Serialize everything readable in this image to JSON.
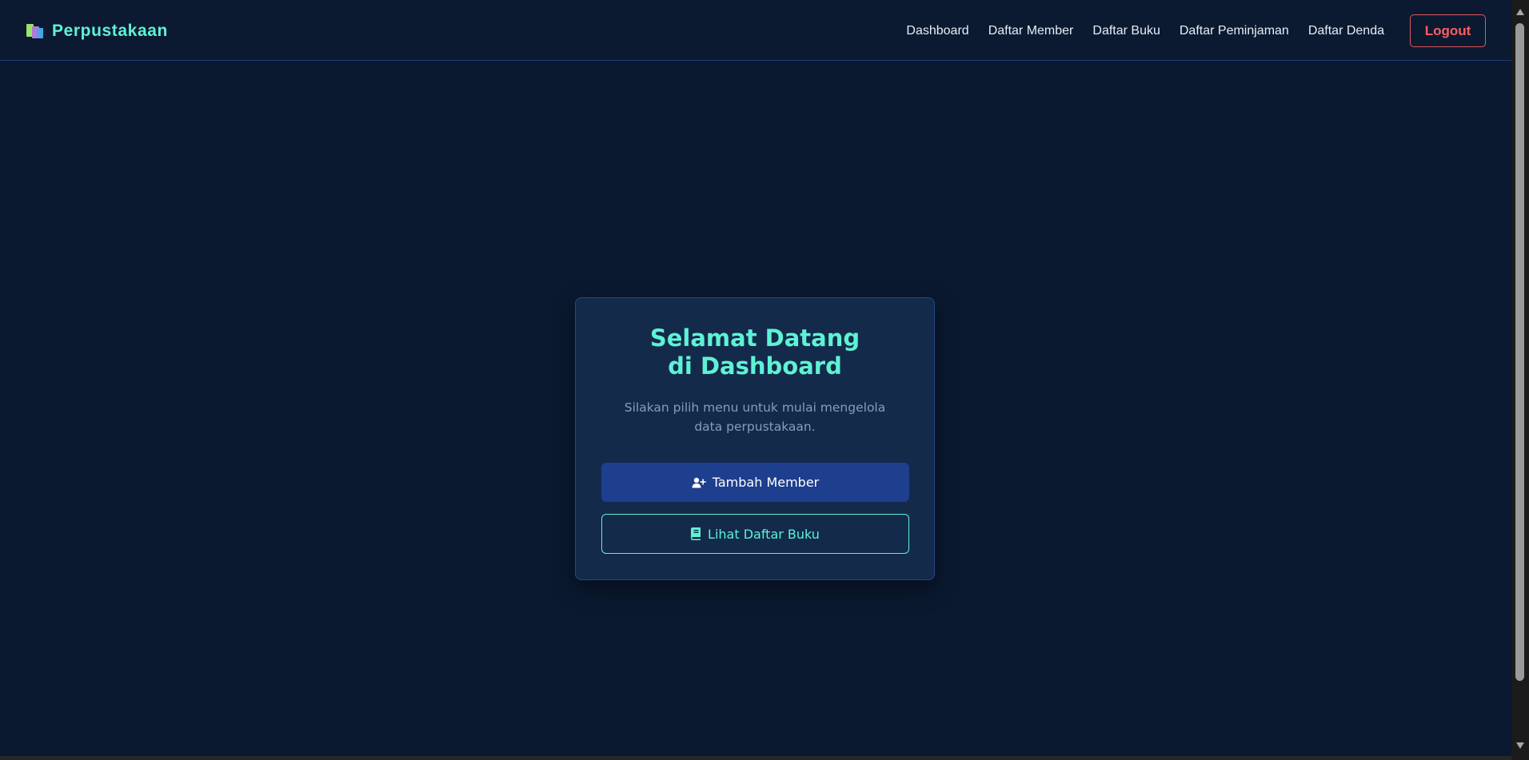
{
  "brand": {
    "title": "Perpustakaan",
    "icon": "books-icon"
  },
  "nav": {
    "links": [
      "Dashboard",
      "Daftar Member",
      "Daftar Buku",
      "Daftar Peminjaman",
      "Daftar Denda"
    ],
    "logout_label": "Logout"
  },
  "card": {
    "title": "Selamat Datang di Dashboard",
    "subtitle": "Silakan pilih menu untuk mulai mengelola data perpustakaan.",
    "primary_button": {
      "label": "Tambah Member",
      "icon": "user-plus-icon"
    },
    "secondary_button": {
      "label": "Lihat Daftar Buku",
      "icon": "book-icon"
    }
  },
  "colors": {
    "background": "#0a1930",
    "accent": "#5ef2d4",
    "primary": "#1e3e8e",
    "danger": "#ff5d60"
  }
}
